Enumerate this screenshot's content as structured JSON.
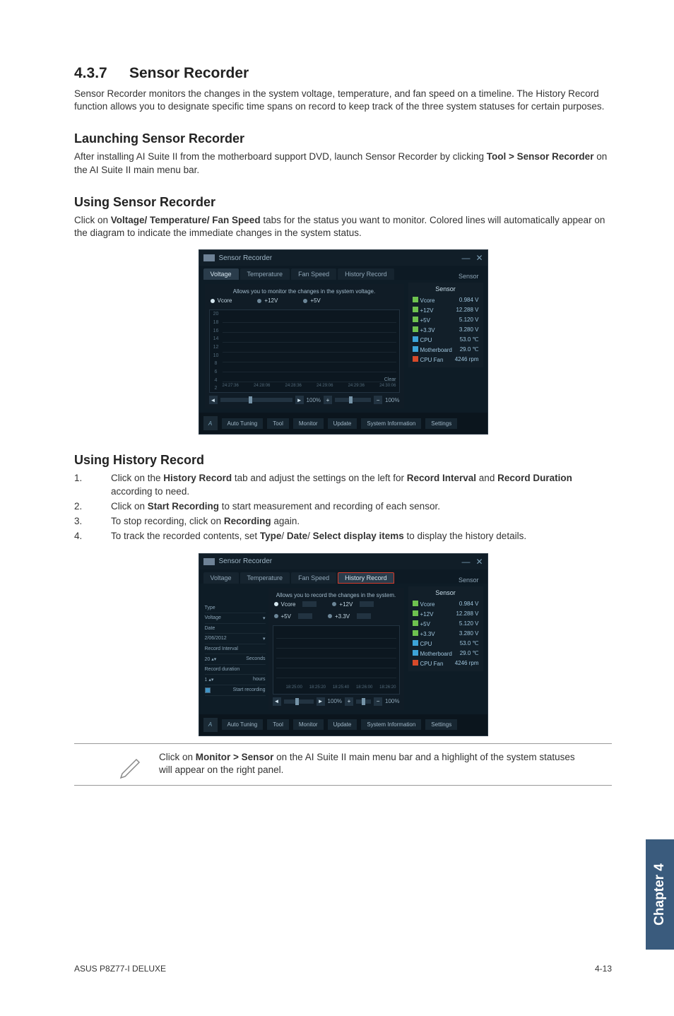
{
  "section": {
    "num": "4.3.7",
    "title": "Sensor Recorder"
  },
  "intro": "Sensor Recorder monitors the changes in the system voltage, temperature, and fan speed on a timeline. The History Record function allows you to designate specific time spans on record to keep track of the three system statuses for certain purposes.",
  "launch": {
    "heading": "Launching Sensor Recorder",
    "body_pre": "After installing AI Suite II from the motherboard support DVD, launch Sensor Recorder by clicking ",
    "body_bold": "Tool > Sensor Recorder",
    "body_post": " on the AI Suite II main menu bar."
  },
  "using": {
    "heading": "Using Sensor Recorder",
    "body_pre": "Click on ",
    "body_bold": "Voltage/ Temperature/ Fan Speed",
    "body_post": " tabs for the status you want to monitor. Colored lines will automatically appear on the diagram to indicate the immediate changes in the system status."
  },
  "history": {
    "heading": "Using History Record",
    "steps": [
      {
        "n": "1.",
        "pre": "Click on the ",
        "b1": "History Record",
        "mid": " tab and adjust the settings on the left for ",
        "b2": "Record Interval",
        "mid2": " and ",
        "b3": "Record Duration",
        "post": " according to need."
      },
      {
        "n": "2.",
        "pre": "Click on ",
        "b1": "Start Recording",
        "mid": " to start measurement and recording of each sensor.",
        "b2": "",
        "mid2": "",
        "b3": "",
        "post": ""
      },
      {
        "n": "3.",
        "pre": "To stop recording, click on ",
        "b1": "Recording",
        "mid": " again.",
        "b2": "",
        "mid2": "",
        "b3": "",
        "post": ""
      },
      {
        "n": "4.",
        "pre": "To track the recorded contents, set ",
        "b1": "Type",
        "mid": "/ ",
        "b2": "Date",
        "mid2": "/ ",
        "b3": "Select display items",
        "post": " to display the history details."
      }
    ]
  },
  "note": {
    "pre": "Click on ",
    "bold": "Monitor > Sensor",
    "post": " on the AI Suite II main menu bar and a highlight of the system statuses will appear on the right panel."
  },
  "shot1": {
    "title": "Sensor Recorder",
    "tabs": [
      "Voltage",
      "Temperature",
      "Fan Speed",
      "History Record"
    ],
    "note_line": "Allows you to monitor the changes in the system voltage.",
    "radios": [
      "Vcore",
      "+12V",
      "+5V"
    ],
    "ylabels": [
      "20",
      "18",
      "16",
      "14",
      "12",
      "10",
      "8",
      "6",
      "4",
      "2"
    ],
    "xlabels": [
      "24:27:36",
      "24:28:06",
      "24:28:36",
      "24:29:06",
      "24:29:36",
      "24:30:06"
    ],
    "zoom": "100%",
    "clear": "Clear",
    "sensor_head": "Sensor",
    "sensors": [
      {
        "name": "Vcore",
        "val": "0.984 V",
        "ico": "icogreen"
      },
      {
        "name": "+12V",
        "val": "12.288 V",
        "ico": "icogreen"
      },
      {
        "name": "+5V",
        "val": "5.120 V",
        "ico": "icogreen"
      },
      {
        "name": "+3.3V",
        "val": "3.280 V",
        "ico": "icogreen"
      },
      {
        "name": "CPU",
        "val": "53.0 ℃",
        "ico": "icoblue"
      },
      {
        "name": "Motherboard",
        "val": "29.0 ℃",
        "ico": "icoblue"
      },
      {
        "name": "CPU Fan",
        "val": "4246 rpm",
        "ico": "icored"
      }
    ],
    "bottom": [
      "Tool",
      "Monitor",
      "Update",
      "System Information",
      "Settings"
    ]
  },
  "shot2": {
    "title": "Sensor Recorder",
    "tabs": [
      "Voltage",
      "Temperature",
      "Fan Speed",
      "History Record"
    ],
    "note_line": "Allows you to record the changes in the system.",
    "radios1": [
      "Vcore",
      "+12V"
    ],
    "radios2": [
      "+5V",
      "+3.3V"
    ],
    "left": {
      "type": "Type",
      "voltage": "Voltage",
      "date": "Date",
      "datev": "2/06/2012",
      "ri": "Record Interval",
      "riv": "20",
      "sec": "Seconds",
      "rd": "Record duration",
      "rdv": "1",
      "hr": "hours",
      "start": "Start recording"
    },
    "xlabels": [
      "18:25:00",
      "18:25:20",
      "18:25:40",
      "18:26:00",
      "18:26:20"
    ]
  },
  "sidebar": "Chapter 4",
  "footer": {
    "left": "ASUS P8Z77-I DELUXE",
    "right": "4-13"
  }
}
